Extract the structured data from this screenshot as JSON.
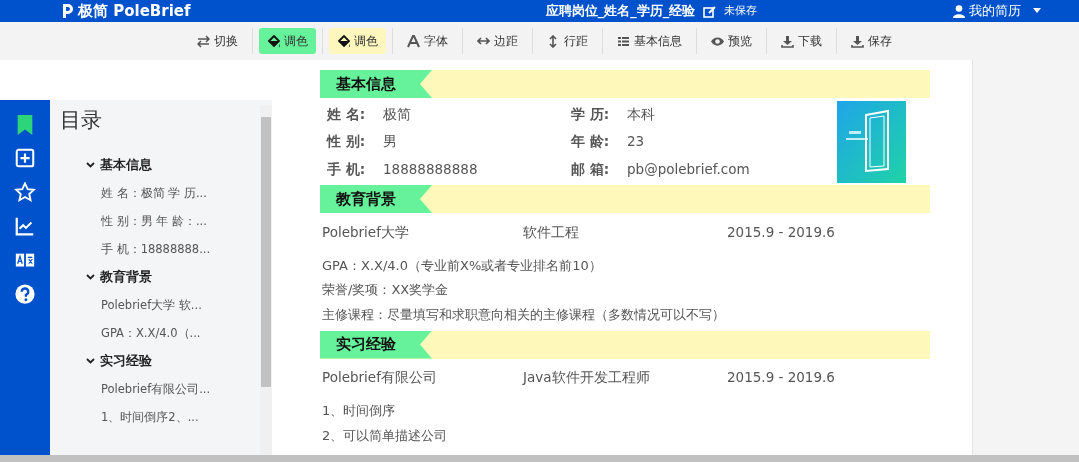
{
  "app": {
    "logo": "极简 PoleBrief"
  },
  "header": {
    "title": "应聘岗位_姓名_学历_经验",
    "status": "未保存",
    "user_menu": "我的简历"
  },
  "toolbar": [
    {
      "kind": "swap",
      "label": "切换"
    },
    {
      "kind": "paint",
      "label": "调色",
      "color": "#66f29b"
    },
    {
      "kind": "paint",
      "label": "调色",
      "color": "#fdf7bd"
    },
    {
      "kind": "font",
      "label": "字体"
    },
    {
      "kind": "margin",
      "label": "边距"
    },
    {
      "kind": "spacing",
      "label": "行距"
    },
    {
      "kind": "list",
      "label": "基本信息"
    },
    {
      "kind": "eye",
      "label": "预览"
    },
    {
      "kind": "download",
      "label": "下载"
    },
    {
      "kind": "download",
      "label": "保存"
    }
  ],
  "rail": [
    {
      "kind": "bookmark",
      "selected": true
    },
    {
      "kind": "add",
      "selected": false
    },
    {
      "kind": "star",
      "selected": false
    },
    {
      "kind": "chart",
      "selected": false
    },
    {
      "kind": "translate",
      "selected": false
    },
    {
      "kind": "help",
      "selected": false
    }
  ],
  "toc": {
    "title": "目录",
    "sections": [
      {
        "label": "基本信息",
        "expanded": true,
        "children": [
          {
            "label": "姓 名：极简 学 历..."
          },
          {
            "label": "性 别：男 年 龄：..."
          },
          {
            "label": "手 机：18888888..."
          }
        ]
      },
      {
        "label": "教育背景",
        "expanded": true,
        "children": [
          {
            "label": "Polebrief大学 软..."
          },
          {
            "label": "GPA：X.X/4.0（..."
          }
        ]
      },
      {
        "label": "实习经验",
        "expanded": true,
        "children": [
          {
            "label": "Polebrief有限公司..."
          },
          {
            "label": "1、时间倒序2、..."
          }
        ]
      }
    ]
  },
  "resume": {
    "sections": [
      {
        "kind": "info",
        "title": "基本信息",
        "fields": [
          {
            "label": "姓 名:",
            "value": "极简"
          },
          {
            "label": "学 历:",
            "value": "本科"
          },
          {
            "label": "性 别:",
            "value": "男"
          },
          {
            "label": "年 龄:",
            "value": "23"
          },
          {
            "label": "手 机:",
            "value": "18888888888"
          },
          {
            "label": "邮 箱:",
            "value": "pb@polebrief.com"
          }
        ]
      },
      {
        "kind": "entry",
        "title": "教育背景",
        "row": [
          "Polebrief大学",
          "软件工程",
          "2015.9 - 2019.6"
        ],
        "lines": [
          "GPA：X.X/4.0（专业前X%或者专业排名前10）",
          "荣誉/奖项：XX奖学金",
          "主修课程：尽量填写和求职意向相关的主修课程（多数情况可以不写）"
        ]
      },
      {
        "kind": "entry",
        "title": "实习经验",
        "row": [
          "Polebrief有限公司",
          "Java软件开发工程师",
          "2015.9 - 2019.6"
        ],
        "lines": [
          "1、时间倒序",
          "2、可以简单描述公司"
        ]
      }
    ]
  }
}
